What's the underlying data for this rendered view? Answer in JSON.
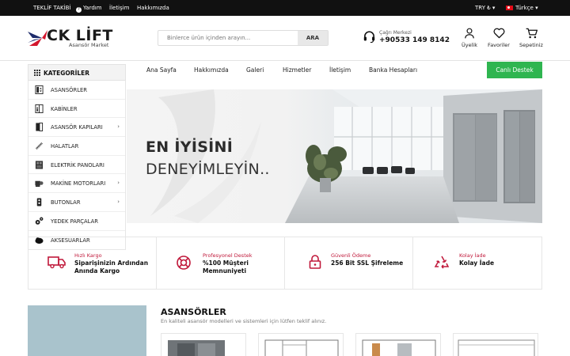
{
  "topbar": {
    "links": [
      "TEKLİF TAKİBİ",
      "Yardım",
      "İletişim",
      "Hakkımızda"
    ],
    "currency": "TRY ₺ ▾",
    "language": "Türkçe ▾"
  },
  "header": {
    "logo_text": "CK LİFT",
    "logo_subtitle": "Asansör Market",
    "search_placeholder": "Binlerce ürün içinden arayın...",
    "search_button": "ARA",
    "call_center_label": "Çağrı Merkezi",
    "call_center_number": "+90533 149 8142",
    "account_label": "Üyelik",
    "favorites_label": "Favoriler",
    "cart_label": "Sepetiniz"
  },
  "nav": {
    "categories_title": "KATEGORİLER",
    "items": [
      "Ana Sayfa",
      "Hakkımızda",
      "Galeri",
      "Hizmetler",
      "İletişim",
      "Banka Hesapları"
    ],
    "live_support": "Canlı Destek"
  },
  "categories": [
    {
      "label": "ASANSÖRLER",
      "icon": "elevator-icon",
      "has_sub": false
    },
    {
      "label": "KABİNLER",
      "icon": "cabin-icon",
      "has_sub": false
    },
    {
      "label": "ASANSÖR KAPILARI",
      "icon": "door-icon",
      "has_sub": true
    },
    {
      "label": "HALATLAR",
      "icon": "rope-icon",
      "has_sub": false
    },
    {
      "label": "ELEKTRİK PANOLARI",
      "icon": "panel-icon",
      "has_sub": false
    },
    {
      "label": "MAKİNE MOTORLARI",
      "icon": "motor-icon",
      "has_sub": true
    },
    {
      "label": "BUTONLAR",
      "icon": "button-icon",
      "has_sub": true
    },
    {
      "label": "YEDEK PARÇALAR",
      "icon": "gears-icon",
      "has_sub": false
    },
    {
      "label": "AKSESUARLAR",
      "icon": "accessory-icon",
      "has_sub": false
    }
  ],
  "hero": {
    "line1": "EN İYİSİNİ",
    "line2": "DENEYİMLEYİN..",
    "slide_count": 4,
    "active_slide": 1
  },
  "features": [
    {
      "key": "Hızlı Kargo",
      "value": "Siparişinizin Ardından Anında Kargo",
      "icon": "truck-icon"
    },
    {
      "key": "Profesyonel Destek",
      "value": "%100 Müşteri Memnuniyeti",
      "icon": "lifebuoy-icon"
    },
    {
      "key": "Güvenli Ödeme",
      "value": "256 Bit SSL Şifreleme",
      "icon": "lock-icon"
    },
    {
      "key": "Kolay İade",
      "value": "Kolay İade",
      "icon": "recycle-icon"
    }
  ],
  "section": {
    "title": "ASANSÖRLER",
    "subtitle": "En kaliteli asansör modelleri ve sistemleri için lütfen teklif alınız."
  },
  "colors": {
    "topbar": "#111111",
    "accent_red": "#c0183a",
    "live_support_green": "#2fb550"
  }
}
